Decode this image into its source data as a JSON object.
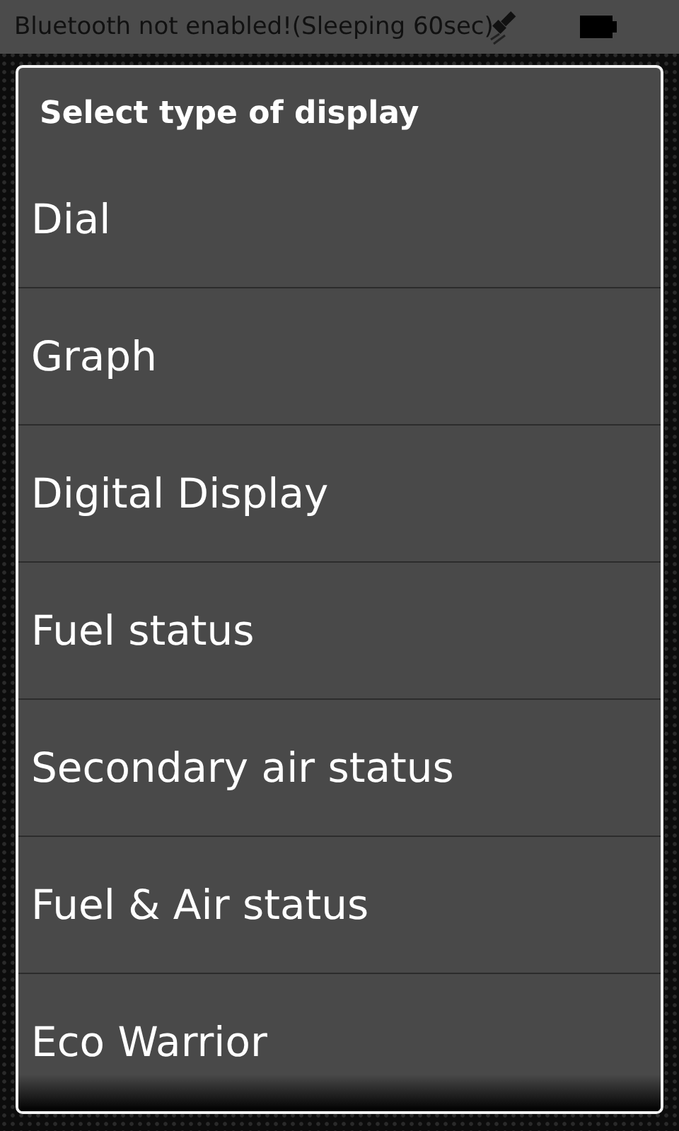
{
  "status_bar": {
    "message": "Bluetooth not enabled!(Sleeping 60sec)"
  },
  "dialog": {
    "title": "Select type of display",
    "items": [
      {
        "label": "Dial"
      },
      {
        "label": "Graph"
      },
      {
        "label": "Digital Display"
      },
      {
        "label": "Fuel status"
      },
      {
        "label": "Secondary air status"
      },
      {
        "label": "Fuel & Air status"
      },
      {
        "label": "Eco Warrior"
      }
    ]
  }
}
